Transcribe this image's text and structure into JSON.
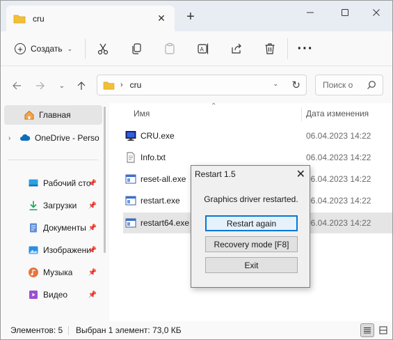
{
  "tab": {
    "title": "cru"
  },
  "toolbar": {
    "create_label": "Создать"
  },
  "address": {
    "crumb": "cru"
  },
  "search": {
    "placeholder": "Поиск в: cru",
    "shown": "Поиск о"
  },
  "sidebar": {
    "items": [
      {
        "label": "Главная",
        "icon": "home-icon",
        "selected": true
      },
      {
        "label": "OneDrive - Perso",
        "icon": "cloud-icon"
      },
      {
        "label": "Рабочий сто",
        "icon": "desktop-icon",
        "pinned": true
      },
      {
        "label": "Загрузки",
        "icon": "download-icon",
        "pinned": true
      },
      {
        "label": "Документы",
        "icon": "document-icon",
        "pinned": true
      },
      {
        "label": "Изображени",
        "icon": "image-icon",
        "pinned": true
      },
      {
        "label": "Музыка",
        "icon": "music-icon",
        "pinned": true
      },
      {
        "label": "Видео",
        "icon": "video-icon",
        "pinned": true
      }
    ]
  },
  "columns": {
    "name": "Имя",
    "date": "Дата изменения"
  },
  "files": [
    {
      "name": "CRU.exe",
      "date": "06.04.2023 14:22",
      "icon": "monitor-exe-icon"
    },
    {
      "name": "Info.txt",
      "date": "06.04.2023 14:22",
      "icon": "text-file-icon"
    },
    {
      "name": "reset-all.exe",
      "date": "06.04.2023 14:22",
      "icon": "exe-icon"
    },
    {
      "name": "restart.exe",
      "date": "06.04.2023 14:22",
      "icon": "exe-icon"
    },
    {
      "name": "restart64.exe",
      "date": "06.04.2023 14:22",
      "icon": "exe-icon",
      "selected": true
    }
  ],
  "status": {
    "count": "Элементов: 5",
    "selection": "Выбран 1 элемент: 73,0 КБ"
  },
  "dialog": {
    "title": "Restart 1.5",
    "message": "Graphics driver restarted.",
    "buttons": {
      "restart_again": "Restart again",
      "recovery_mode": "Recovery mode [F8]",
      "exit": "Exit"
    }
  },
  "colors": {
    "folder": "#f2c037",
    "accent": "#0078d7",
    "selection": "#e5e5e5"
  }
}
